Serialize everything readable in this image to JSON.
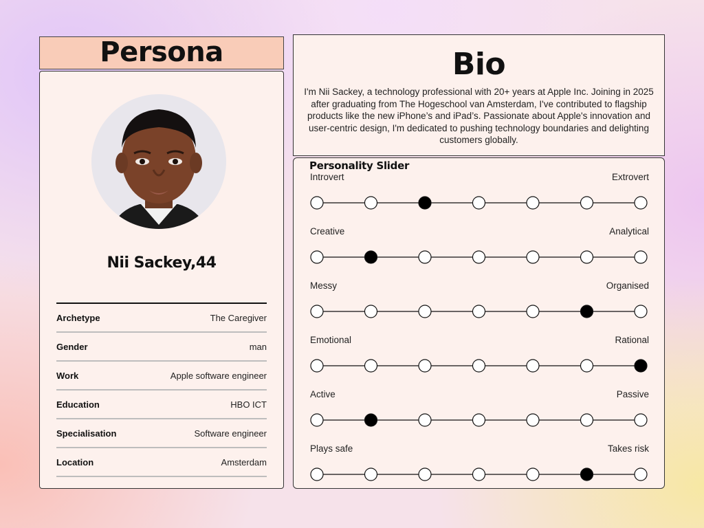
{
  "persona": {
    "header": "Persona",
    "name_line": "Nii Sackey,44",
    "attributes": [
      {
        "label": "Archetype",
        "value": "The Caregiver"
      },
      {
        "label": "Gender",
        "value": "man"
      },
      {
        "label": "Work",
        "value": "Apple software engineer"
      },
      {
        "label": "Education",
        "value": "HBO ICT"
      },
      {
        "label": "Specialisation",
        "value": "Software engineer"
      },
      {
        "label": "Location",
        "value": "Amsterdam"
      }
    ]
  },
  "bio": {
    "title": "Bio",
    "text": "I'm Nii Sackey, a technology professional with 20+ years at Apple Inc. Joining in 2025 after graduating from The Hogeschool van Amsterdam, I've contributed to flagship products like the new iPhone’s and iPad’s. Passionate about Apple's innovation and user-centric design, I'm dedicated to pushing technology boundaries and delighting customers globally."
  },
  "personality": {
    "title": "Personality Slider",
    "steps": 7,
    "sliders": [
      {
        "left": "Introvert",
        "right": "Extrovert",
        "selected": 3
      },
      {
        "left": "Creative",
        "right": "Analytical",
        "selected": 2
      },
      {
        "left": "Messy",
        "right": "Organised",
        "selected": 6
      },
      {
        "left": "Emotional",
        "right": "Rational",
        "selected": 7
      },
      {
        "left": "Active",
        "right": "Passive",
        "selected": 2
      },
      {
        "left": "Plays safe",
        "right": "Takes risk",
        "selected": 6
      }
    ]
  },
  "colors": {
    "header_fill": "#f9ccb8",
    "card_fill": "#fdf1ed",
    "selected_dot": "#000000"
  }
}
